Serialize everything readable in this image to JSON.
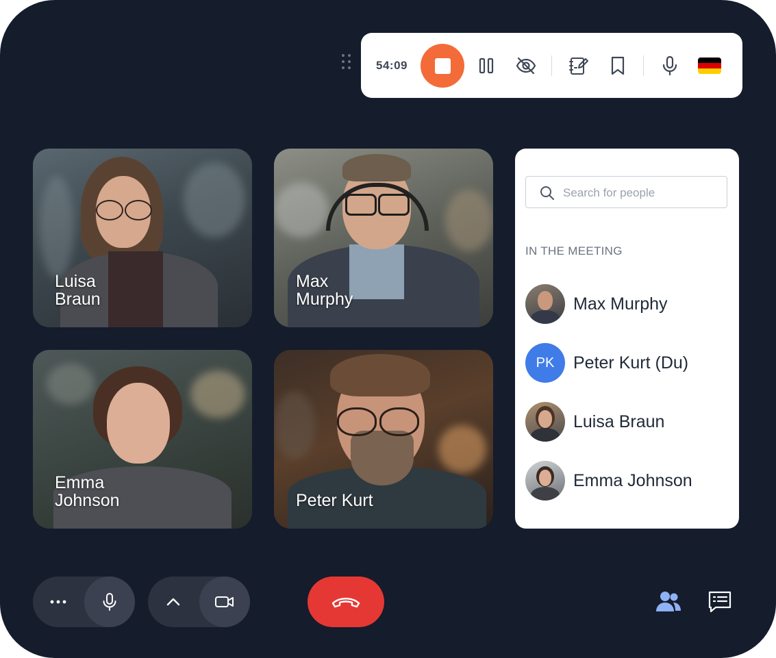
{
  "recording": {
    "timer": "54:09",
    "icons": [
      "stop-icon",
      "pause-icon",
      "eye-off-icon",
      "notes-icon",
      "bookmark-icon",
      "microphone-icon",
      "flag-germany-icon"
    ],
    "stop_color": "#f36b38",
    "flag_colors": [
      "#000000",
      "#dd0000",
      "#ffce00"
    ]
  },
  "tiles": [
    {
      "name": "Luisa\nBraun"
    },
    {
      "name": "Max\nMurphy"
    },
    {
      "name": "Emma\nJohnson"
    },
    {
      "name": "Peter Kurt"
    }
  ],
  "panel": {
    "search_placeholder": "Search for people",
    "section_label": "IN THE MEETING",
    "people": [
      {
        "name": "Max Murphy",
        "avatar": "photo"
      },
      {
        "name": "Peter Kurt (Du)",
        "avatar": "initials",
        "initials": "PK",
        "avatar_color": "#3f7ce8"
      },
      {
        "name": "Luisa Braun",
        "avatar": "photo"
      },
      {
        "name": "Emma Johnson",
        "avatar": "photo"
      }
    ]
  },
  "controls": {
    "left_group_1": [
      "more-icon",
      "microphone-icon"
    ],
    "left_group_2": [
      "chevron-up-icon",
      "camera-icon"
    ],
    "end_call_color": "#e53834",
    "right": [
      "participants-icon",
      "chat-icon"
    ],
    "participants_icon_color": "#8fb1f5"
  },
  "colors": {
    "background": "#151c2c",
    "panel": "#ffffff"
  }
}
